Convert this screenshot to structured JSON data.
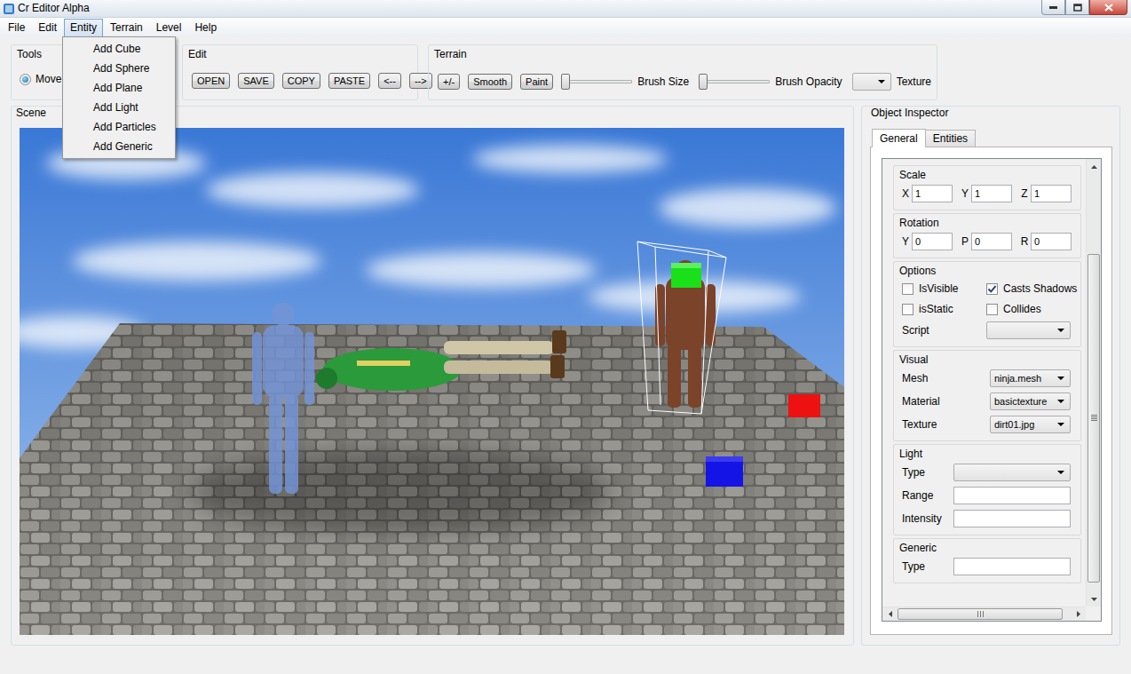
{
  "window": {
    "title": "Cr Editor Alpha"
  },
  "menubar": [
    {
      "label": "File",
      "selected": false
    },
    {
      "label": "Edit",
      "selected": false
    },
    {
      "label": "Entity",
      "selected": true
    },
    {
      "label": "Terrain",
      "selected": false
    },
    {
      "label": "Level",
      "selected": false
    },
    {
      "label": "Help",
      "selected": false
    }
  ],
  "entity_menu": {
    "items": [
      "Add Cube",
      "Add Sphere",
      "Add Plane",
      "Add Light",
      "Add Particles",
      "Add Generic"
    ]
  },
  "tools": {
    "title": "Tools",
    "options": [
      {
        "label": "Move",
        "selected": true
      }
    ]
  },
  "edit": {
    "title": "Edit",
    "buttons": [
      "OPEN",
      "SAVE",
      "COPY",
      "PASTE",
      "<--",
      "-->"
    ]
  },
  "terrain": {
    "title": "Terrain",
    "buttons": [
      "+/-",
      "Smooth",
      "Paint"
    ],
    "sliders": [
      {
        "label": "Brush Size",
        "level": 0
      },
      {
        "label": "Brush Opacity",
        "level": 0
      }
    ],
    "texture": {
      "label": "Texture",
      "value": ""
    }
  },
  "scene": {
    "title": "Scene"
  },
  "inspector": {
    "title": "Object Inspector",
    "tabs": [
      {
        "label": "General",
        "selected": true
      },
      {
        "label": "Entities",
        "selected": false
      }
    ],
    "sections": [
      {
        "title": "Scale",
        "kind": "triple",
        "fields": [
          {
            "label": "X",
            "value": "1"
          },
          {
            "label": "Y",
            "value": "1"
          },
          {
            "label": "Z",
            "value": "1"
          }
        ]
      },
      {
        "title": "Rotation",
        "kind": "triple",
        "fields": [
          {
            "label": "Y",
            "value": "0"
          },
          {
            "label": "P",
            "value": "0"
          },
          {
            "label": "R",
            "value": "0"
          }
        ]
      },
      {
        "title": "Options",
        "kind": "options",
        "checks": [
          {
            "label": "IsVisible",
            "checked": false
          },
          {
            "label": "Casts Shadows",
            "checked": true
          },
          {
            "label": "isStatic",
            "checked": false
          },
          {
            "label": "Collides",
            "checked": false
          }
        ],
        "fields": [
          {
            "label": "Script",
            "kind": "select",
            "value": ""
          }
        ]
      },
      {
        "title": "Visual",
        "kind": "form",
        "fields": [
          {
            "label": "Mesh",
            "kind": "select",
            "value": "ninja.mesh"
          },
          {
            "label": "Material",
            "kind": "select",
            "value": "basictexture"
          },
          {
            "label": "Texture",
            "kind": "select",
            "value": "dirt01.jpg"
          }
        ]
      },
      {
        "title": "Light",
        "kind": "form",
        "fields": [
          {
            "label": "Type",
            "kind": "select",
            "value": ""
          },
          {
            "label": "Range",
            "kind": "input",
            "value": ""
          },
          {
            "label": "Intensity",
            "kind": "input",
            "value": ""
          }
        ]
      },
      {
        "title": "Generic",
        "kind": "form",
        "fields": [
          {
            "label": "Type",
            "kind": "input",
            "value": ""
          }
        ]
      }
    ]
  }
}
